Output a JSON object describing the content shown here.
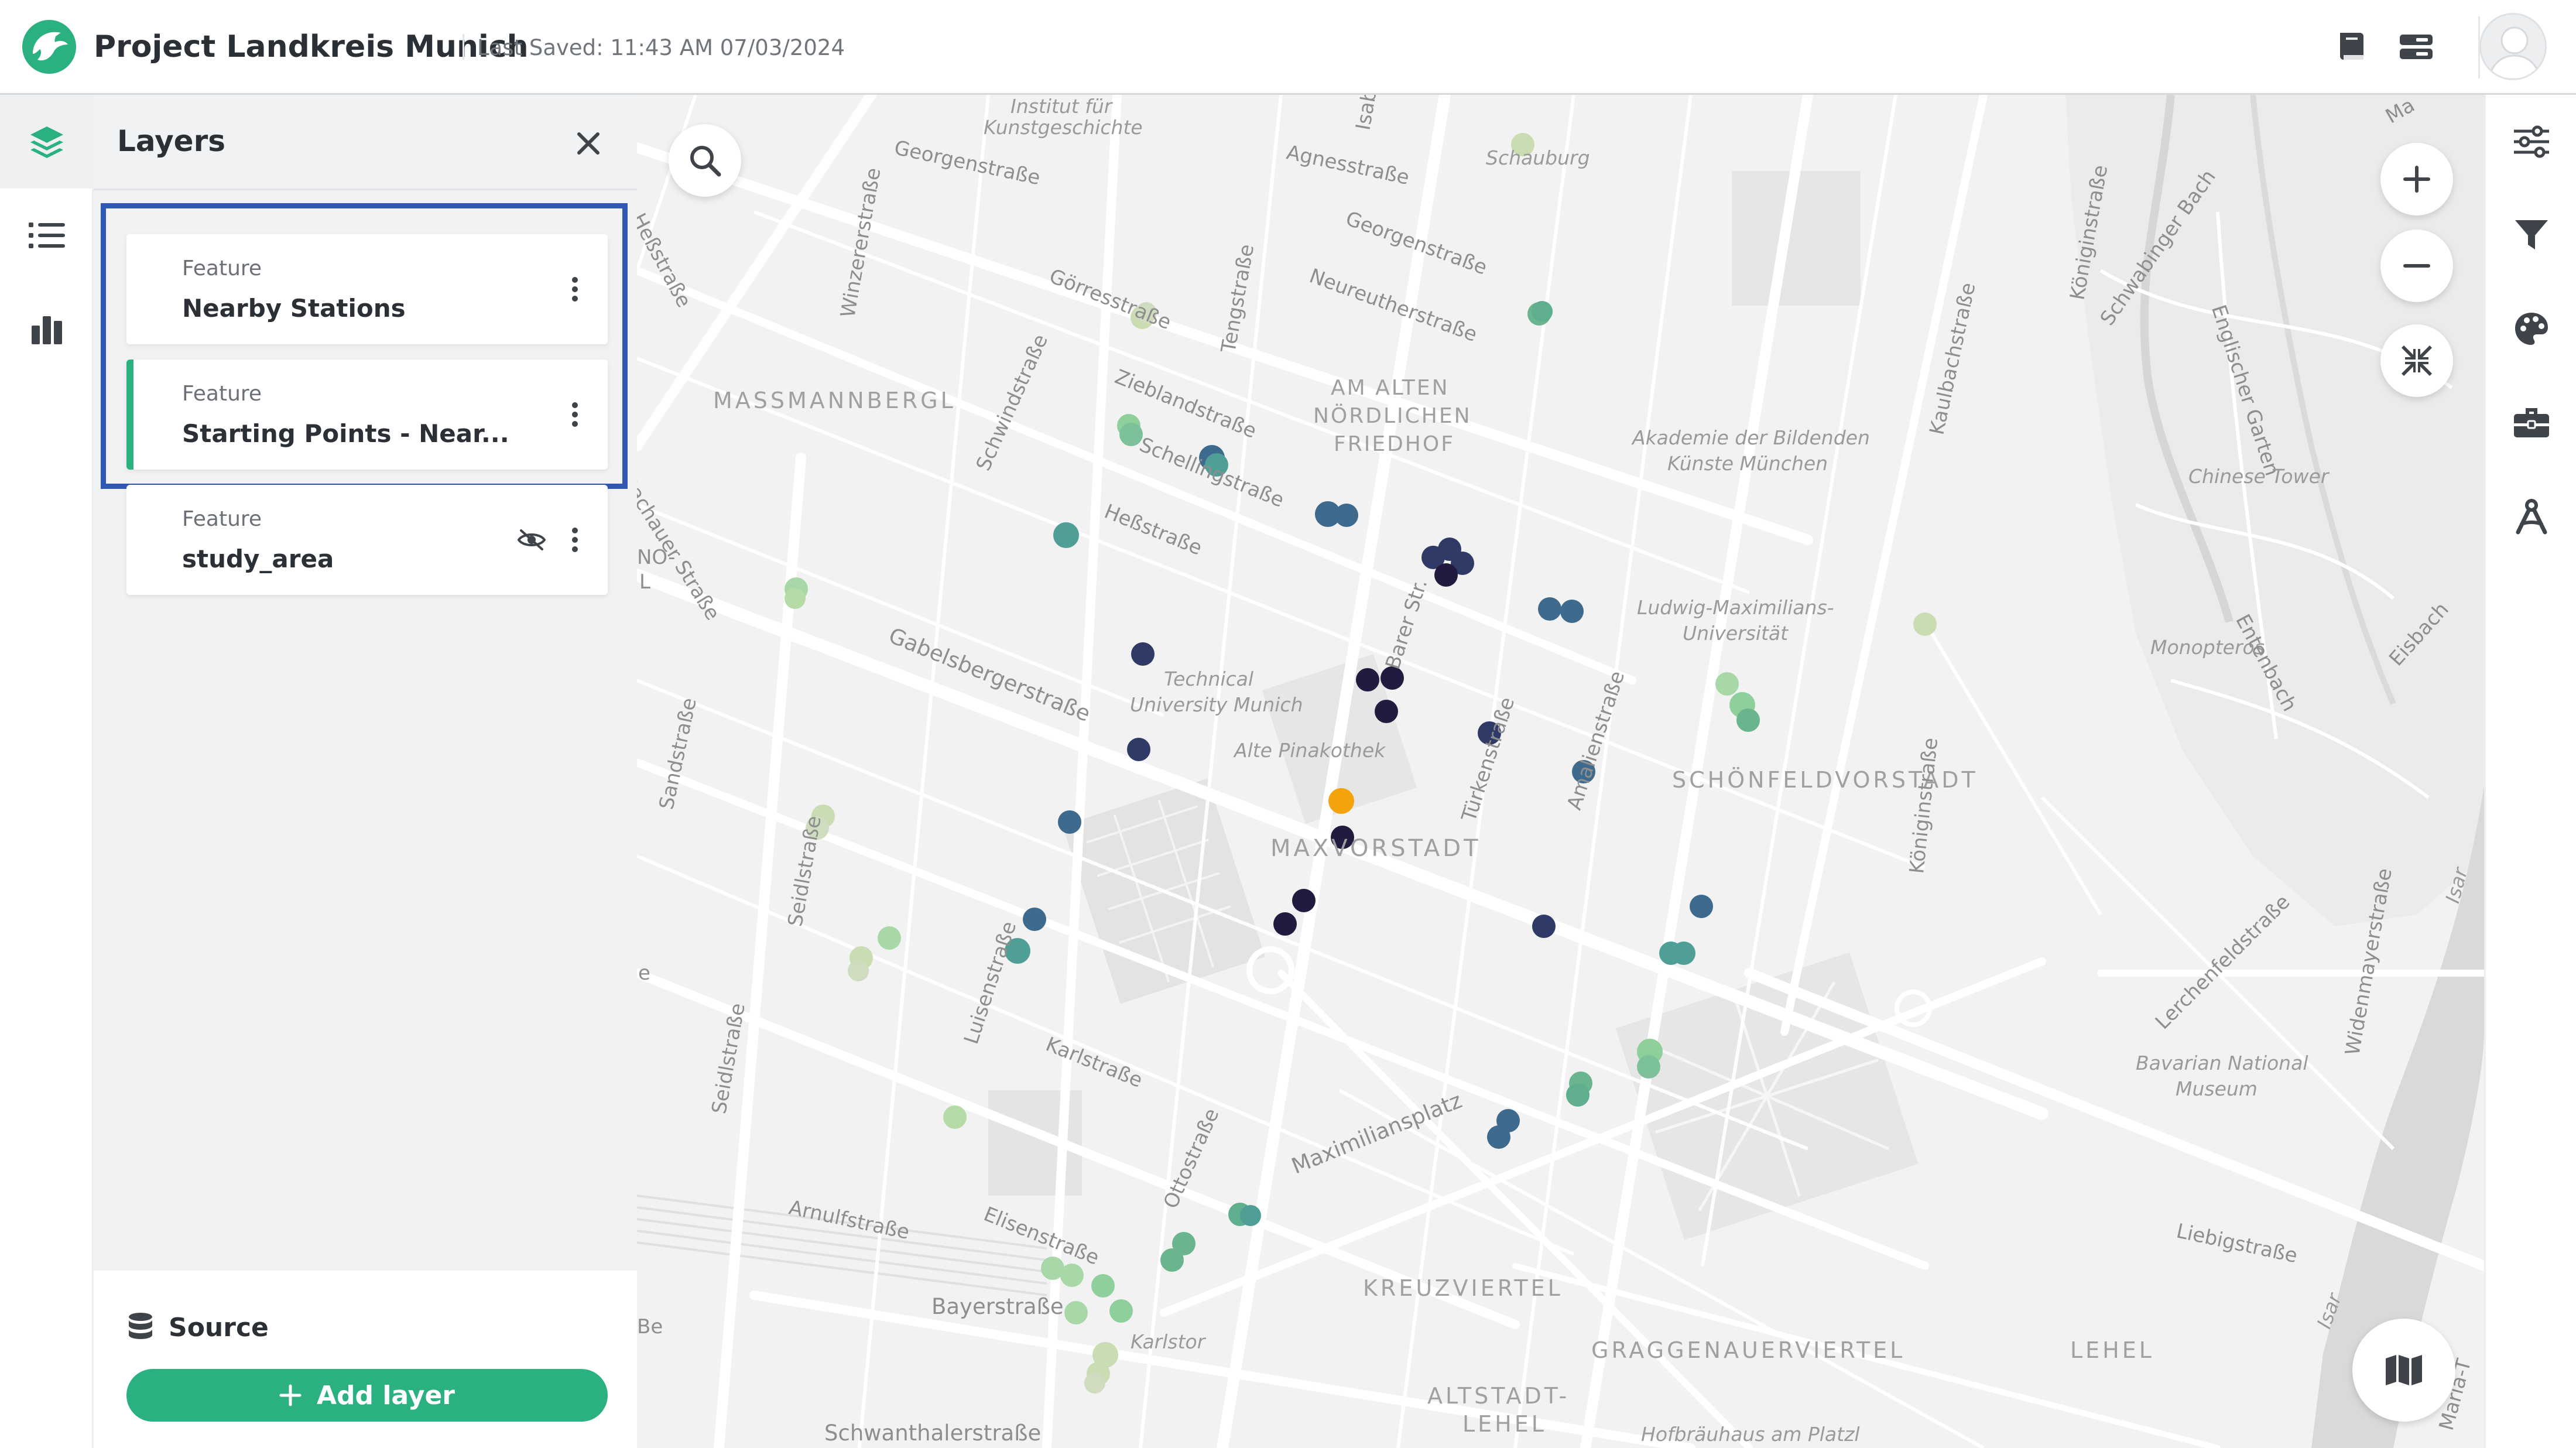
{
  "header": {
    "project_title": "Project Landkreis Munich",
    "last_saved": "Last Saved: 11:43 AM 07/03/2024",
    "icons": [
      "book-icon",
      "layout-icon",
      "avatar"
    ]
  },
  "left_rail": {
    "items": [
      {
        "icon": "layers-icon",
        "active": true
      },
      {
        "icon": "list-icon",
        "active": false
      },
      {
        "icon": "chart-icon",
        "active": false
      }
    ]
  },
  "layers_panel": {
    "title": "Layers",
    "layers": [
      {
        "type": "Feature",
        "name": "Nearby Stations",
        "active": false,
        "hidden": false
      },
      {
        "type": "Feature",
        "name": "Starting Points - Near...",
        "active": true,
        "hidden": false
      },
      {
        "type": "Feature",
        "name": "study_area",
        "active": false,
        "hidden": true
      }
    ],
    "source_label": "Source",
    "add_layer_label": "Add layer"
  },
  "map": {
    "labels": {
      "institut": "Institut für",
      "kunstgeschichte": "Kunstgeschichte",
      "georgenstrasse1": "Georgenstraße",
      "agnesstrasse": "Agnesstraße",
      "schauburg": "Schauburg",
      "georgenstrasse2": "Georgenstraße",
      "neureutherstrasse": "Neureutherstraße",
      "gorresstrasse": "Görresstraße",
      "tengstrasse": "Tengstraße",
      "winzererstrasse": "Winzererstraße",
      "hessstrasse_top": "Heßstraße",
      "massmannbergl": "MASSMANNBERGL",
      "zieblandstrasse": "Zieblandstraße",
      "schellingstrasse": "Schellingstraße",
      "am_alten_1": "AM ALTEN",
      "am_alten_2": "NÖRDLICHEN",
      "am_alten_3": "FRIEDHOF",
      "akademie_1": "Akademie der Bildenden",
      "akademie_2": "Künste München",
      "schwindstrasse": "Schwindstraße",
      "hessstrasse_mid": "Heßstraße",
      "dachauer": "Dachauer Straße",
      "ludwig_1": "Ludwig-Maximilians-",
      "ludwig_2": "Universität",
      "gabelsberger": "Gabelsbergerstraße",
      "technical_1": "Technical",
      "technical_2": "University Munich",
      "alte_pinakothek": "Alte Pinakothek",
      "barer": "Barer Str.",
      "turkenstrasse": "Türkenstraße",
      "amalienstrasse": "Amalienstraße",
      "schonfeld": "SCHÖNFELDVORSTADT",
      "maxvorstadt": "MAXVORSTADT",
      "sandstrasse": "Sandstraße",
      "seidlstrasse1": "Seidlstraße",
      "seidlstrasse2": "Seidlstraße",
      "luisenstrasse": "Luisenstraße",
      "karlstrasse": "Karlstraße",
      "maximiliansplatz": "Maximiliansplatz",
      "arnulfstrasse": "Arnulfstraße",
      "elisenstrasse": "Elisenstraße",
      "ottostrasse": "Ottostraße",
      "bayerstrasse": "Bayerstraße",
      "karlstor": "Karlstor",
      "kreuzviertel": "KREUZVIERTEL",
      "graggenauer": "GRAGGENAUERVIERTEL",
      "lehel_1": "LEHEL",
      "altstadt_1": "ALTSTADT-",
      "altstadt_2": "LEHEL",
      "hofbrauhaus": "Hofbräuhaus am Platzl",
      "schwanthaler": "Schwanthalerstraße",
      "kaulbach": "Kaulbachstraße",
      "koniginstrasse1": "Königinstraße",
      "koniginstrasse2": "Königinstraße",
      "schwabinger": "Schwabinger Bach",
      "englischer": "Englischer Garten",
      "chinese_tower": "Chinese Tower",
      "eisbach": "Eisbach",
      "monopteros": "Monopteros",
      "oberstegbach": "Entenbach",
      "lerchenfeld": "Lerchenfeldstraße",
      "bavarian_1": "Bavarian National",
      "bavarian_2": "Museum",
      "liebigstrasse": "Liebigstraße",
      "widenmayer": "Widenmayerstraße",
      "isar1": "Isar",
      "isar2": "Isar",
      "isab": "Isab",
      "ma": "Ma",
      "maria": "Maria-T",
      "edge_no": "NO-",
      "edge_l": "L",
      "edge_e": "e",
      "edge_be": "Be"
    },
    "legend_colors": {
      "light": "#c9dcb2",
      "green": "#8fcf9c",
      "teal": "#4f9f96",
      "blue": "#3e6a8e",
      "navy": "#2f3b66",
      "dark": "#231a3f",
      "highlight": "#f4a30c"
    },
    "controls": [
      "search-icon",
      "zoom-in-icon",
      "zoom-out-icon",
      "fit-bounds-icon",
      "basemap-icon"
    ]
  },
  "right_rail": {
    "items": [
      "sliders-icon",
      "filter-icon",
      "palette-icon",
      "toolbox-icon",
      "analysis-icon"
    ]
  }
}
